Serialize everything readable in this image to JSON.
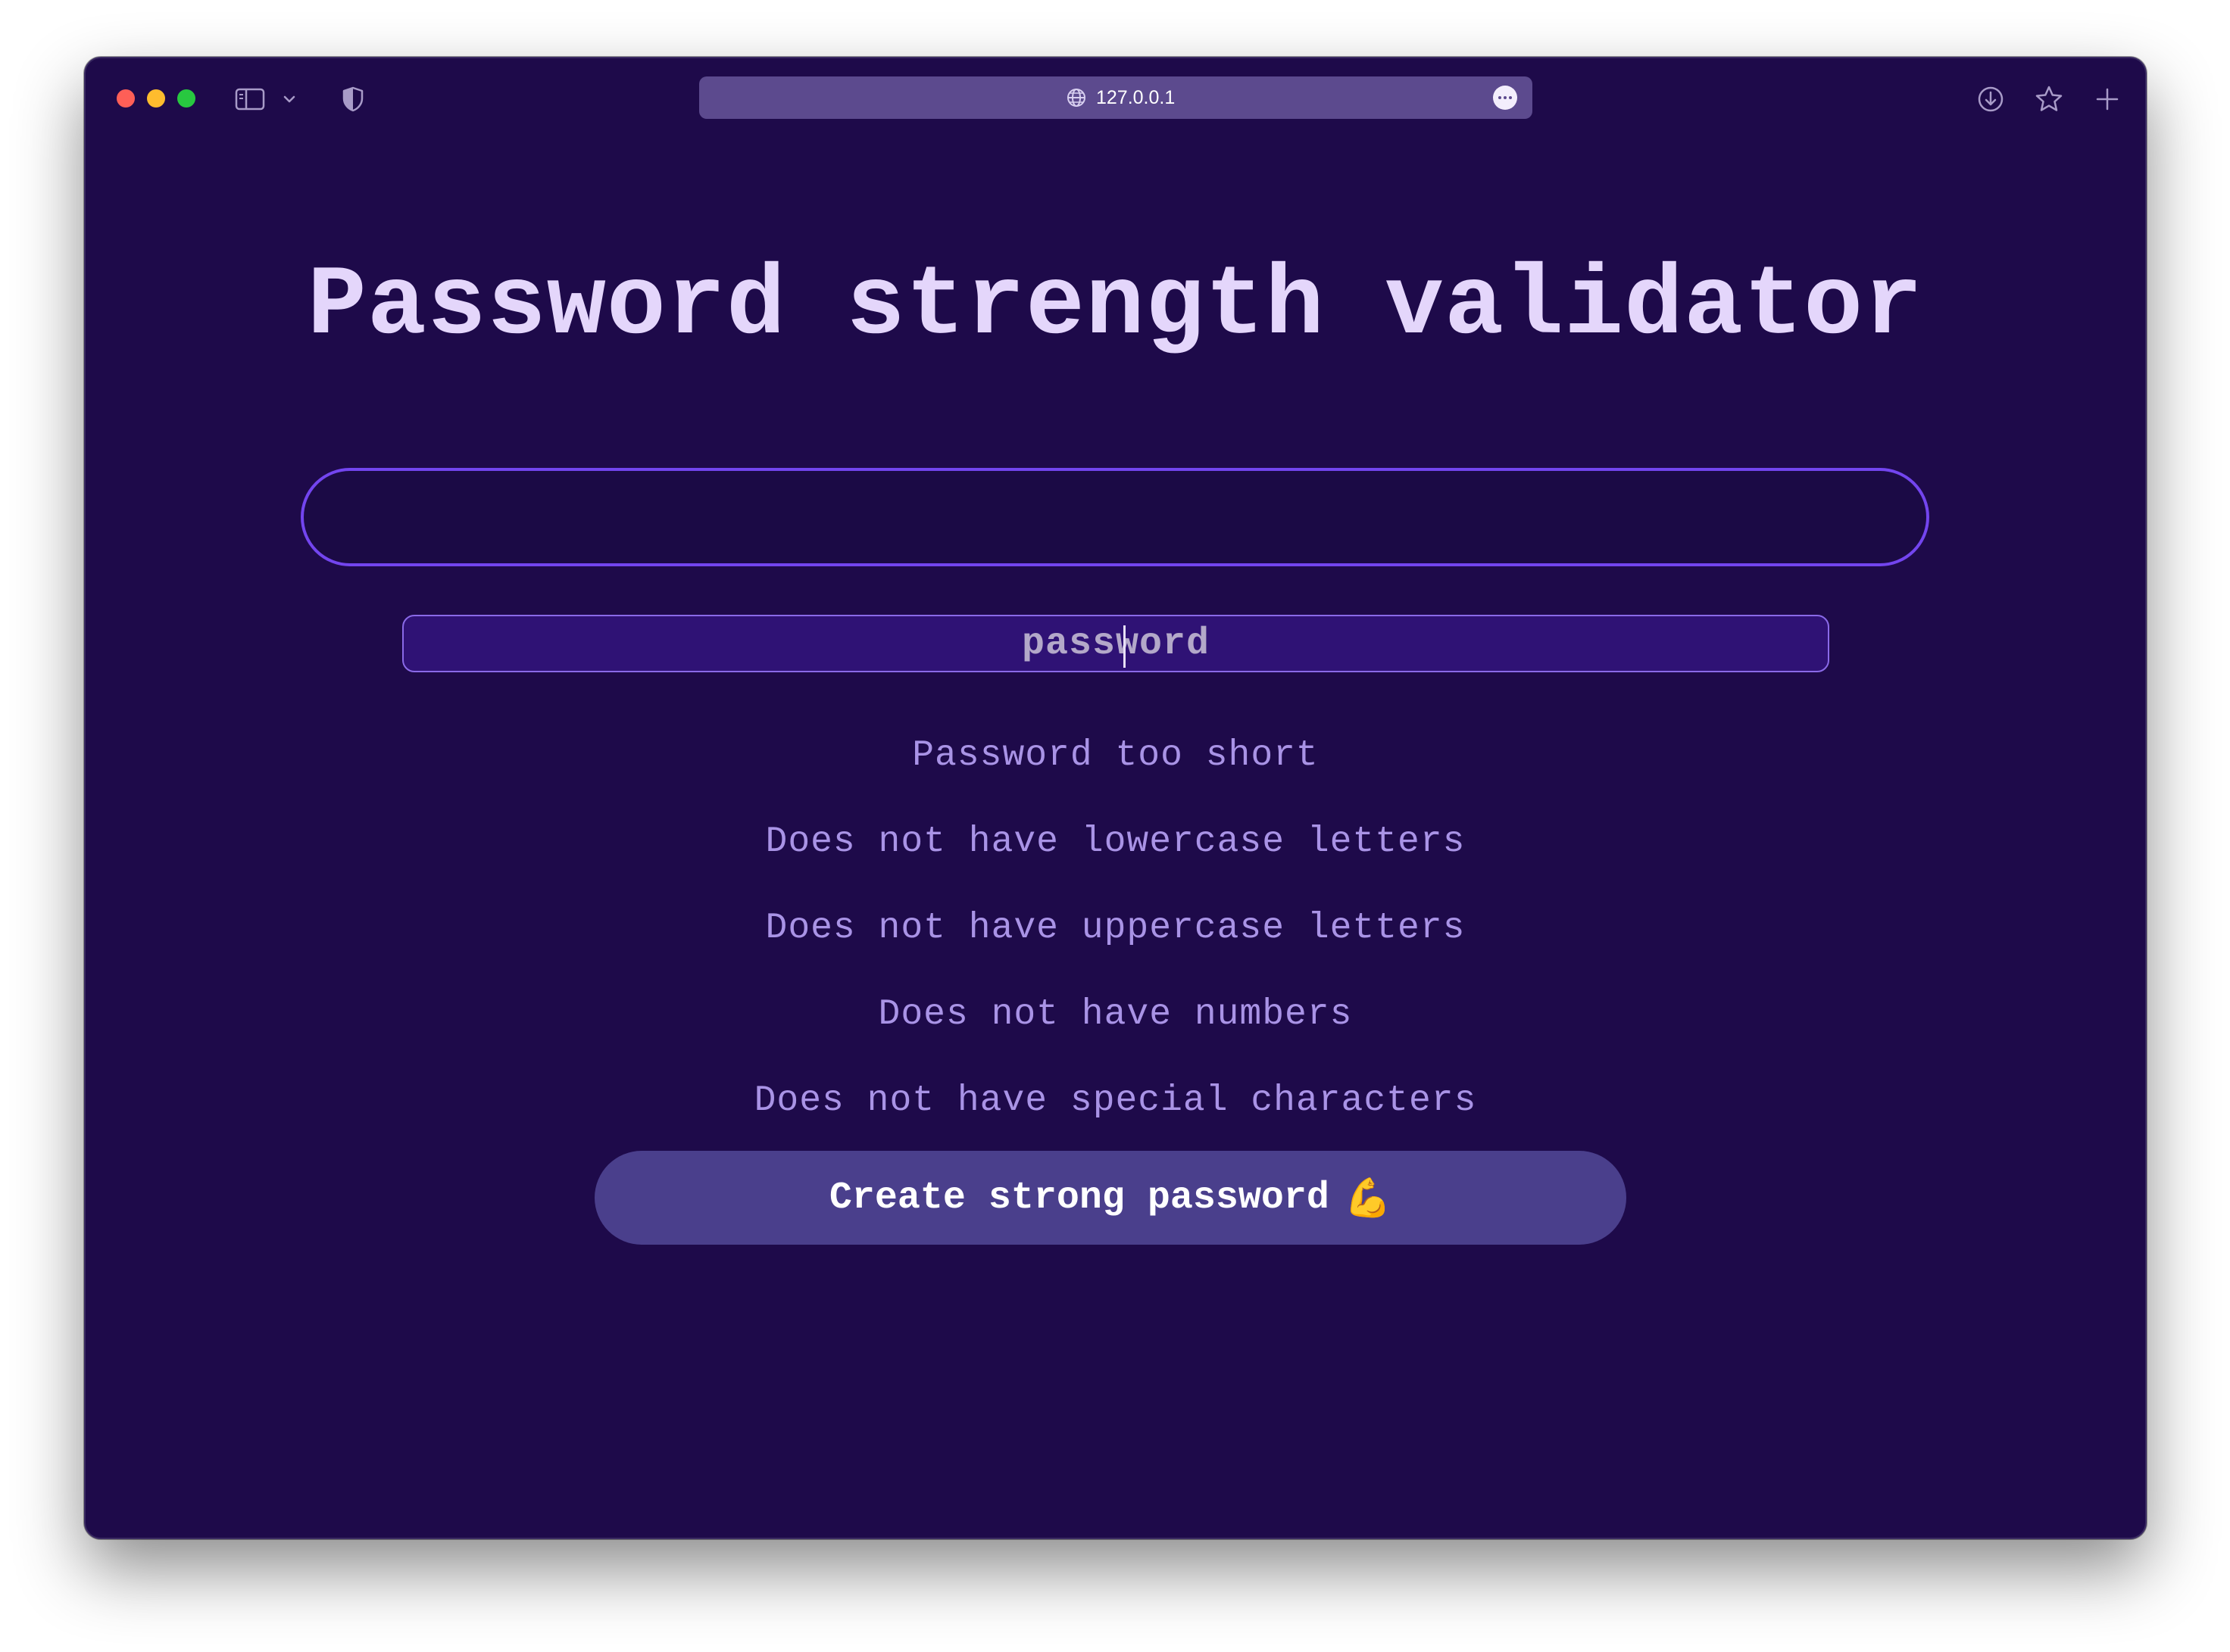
{
  "browser": {
    "url": "127.0.0.1",
    "icons": {
      "sidebar_toggle": "sidebar-icon",
      "sidebar_chevron": "chevron-down-icon",
      "privacy": "shield-icon",
      "site": "globe-icon",
      "more": "ellipsis-icon",
      "download": "download-icon",
      "bookmark": "star-icon",
      "new_tab": "plus-icon"
    }
  },
  "page": {
    "title": "Password strength validator",
    "generated_password_value": "",
    "password_value": "password",
    "messages": [
      "Password too short",
      "Does not have lowercase letters",
      "Does not have uppercase letters",
      "Does not have numbers",
      "Does not have special characters"
    ],
    "create_button_label": "Create strong password",
    "create_button_emoji": "💪"
  },
  "colors": {
    "background": "#1e0a4a",
    "title": "#e4d6fb",
    "accent_border": "#7345ef",
    "input_background": "#2f1275",
    "message_text": "#a993e6",
    "button_background": "#4a3f8c"
  }
}
